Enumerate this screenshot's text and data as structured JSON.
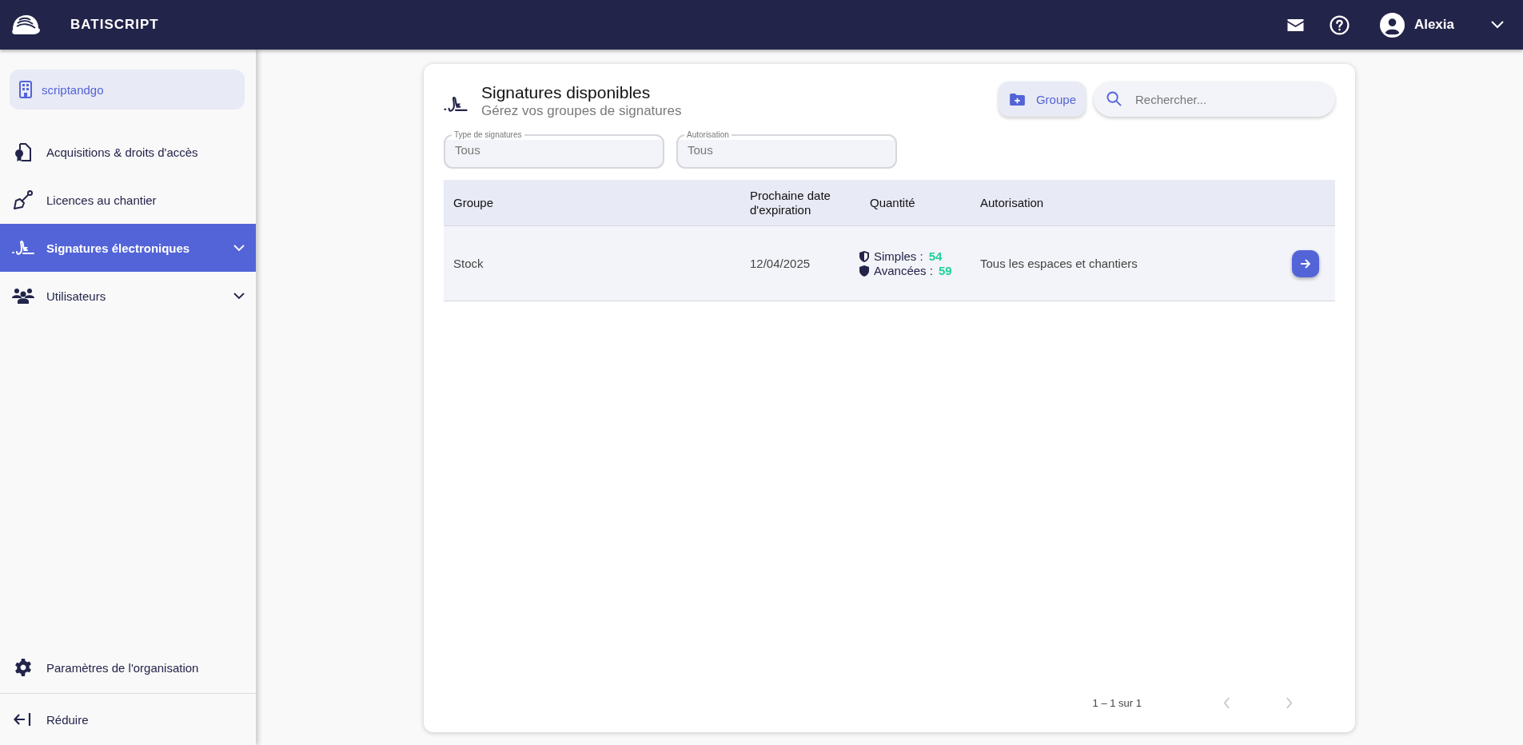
{
  "topbar": {
    "brand": "BATISCRIPT",
    "user": "Alexia"
  },
  "sidebar": {
    "organization": "scriptandgo",
    "items": [
      {
        "label": "Acquisitions & droits d'accès",
        "selected": false,
        "expandable": false
      },
      {
        "label": "Licences au chantier",
        "selected": false,
        "expandable": false
      },
      {
        "label": "Signatures électroniques",
        "selected": true,
        "expandable": true
      },
      {
        "label": "Utilisateurs",
        "selected": false,
        "expandable": true
      }
    ],
    "settings": "Paramètres de l'organisation",
    "collapse": "Réduire"
  },
  "page": {
    "title": "Signatures disponibles",
    "subtitle": "Gérez vos groupes de signatures",
    "add_button": "Groupe",
    "search": {
      "placeholder": "Rechercher..."
    }
  },
  "filters": [
    {
      "label": "Type de signatures",
      "value": "Tous"
    },
    {
      "label": "Autorisation",
      "value": "Tous"
    }
  ],
  "table": {
    "columns": [
      "Groupe",
      "Prochaine date d'expiration",
      "Quantité",
      "Autorisation"
    ],
    "rows": [
      {
        "group": "Stock",
        "expiration": "12/04/2025",
        "simple_label": "Simples :",
        "simple_count": "54",
        "advanced_label": "Avancées :",
        "advanced_count": "59",
        "authorization": "Tous les espaces et chantiers"
      }
    ]
  },
  "pagination": {
    "range": "1 – 1 sur 1",
    "prev_disabled": true,
    "next_disabled": true
  }
}
